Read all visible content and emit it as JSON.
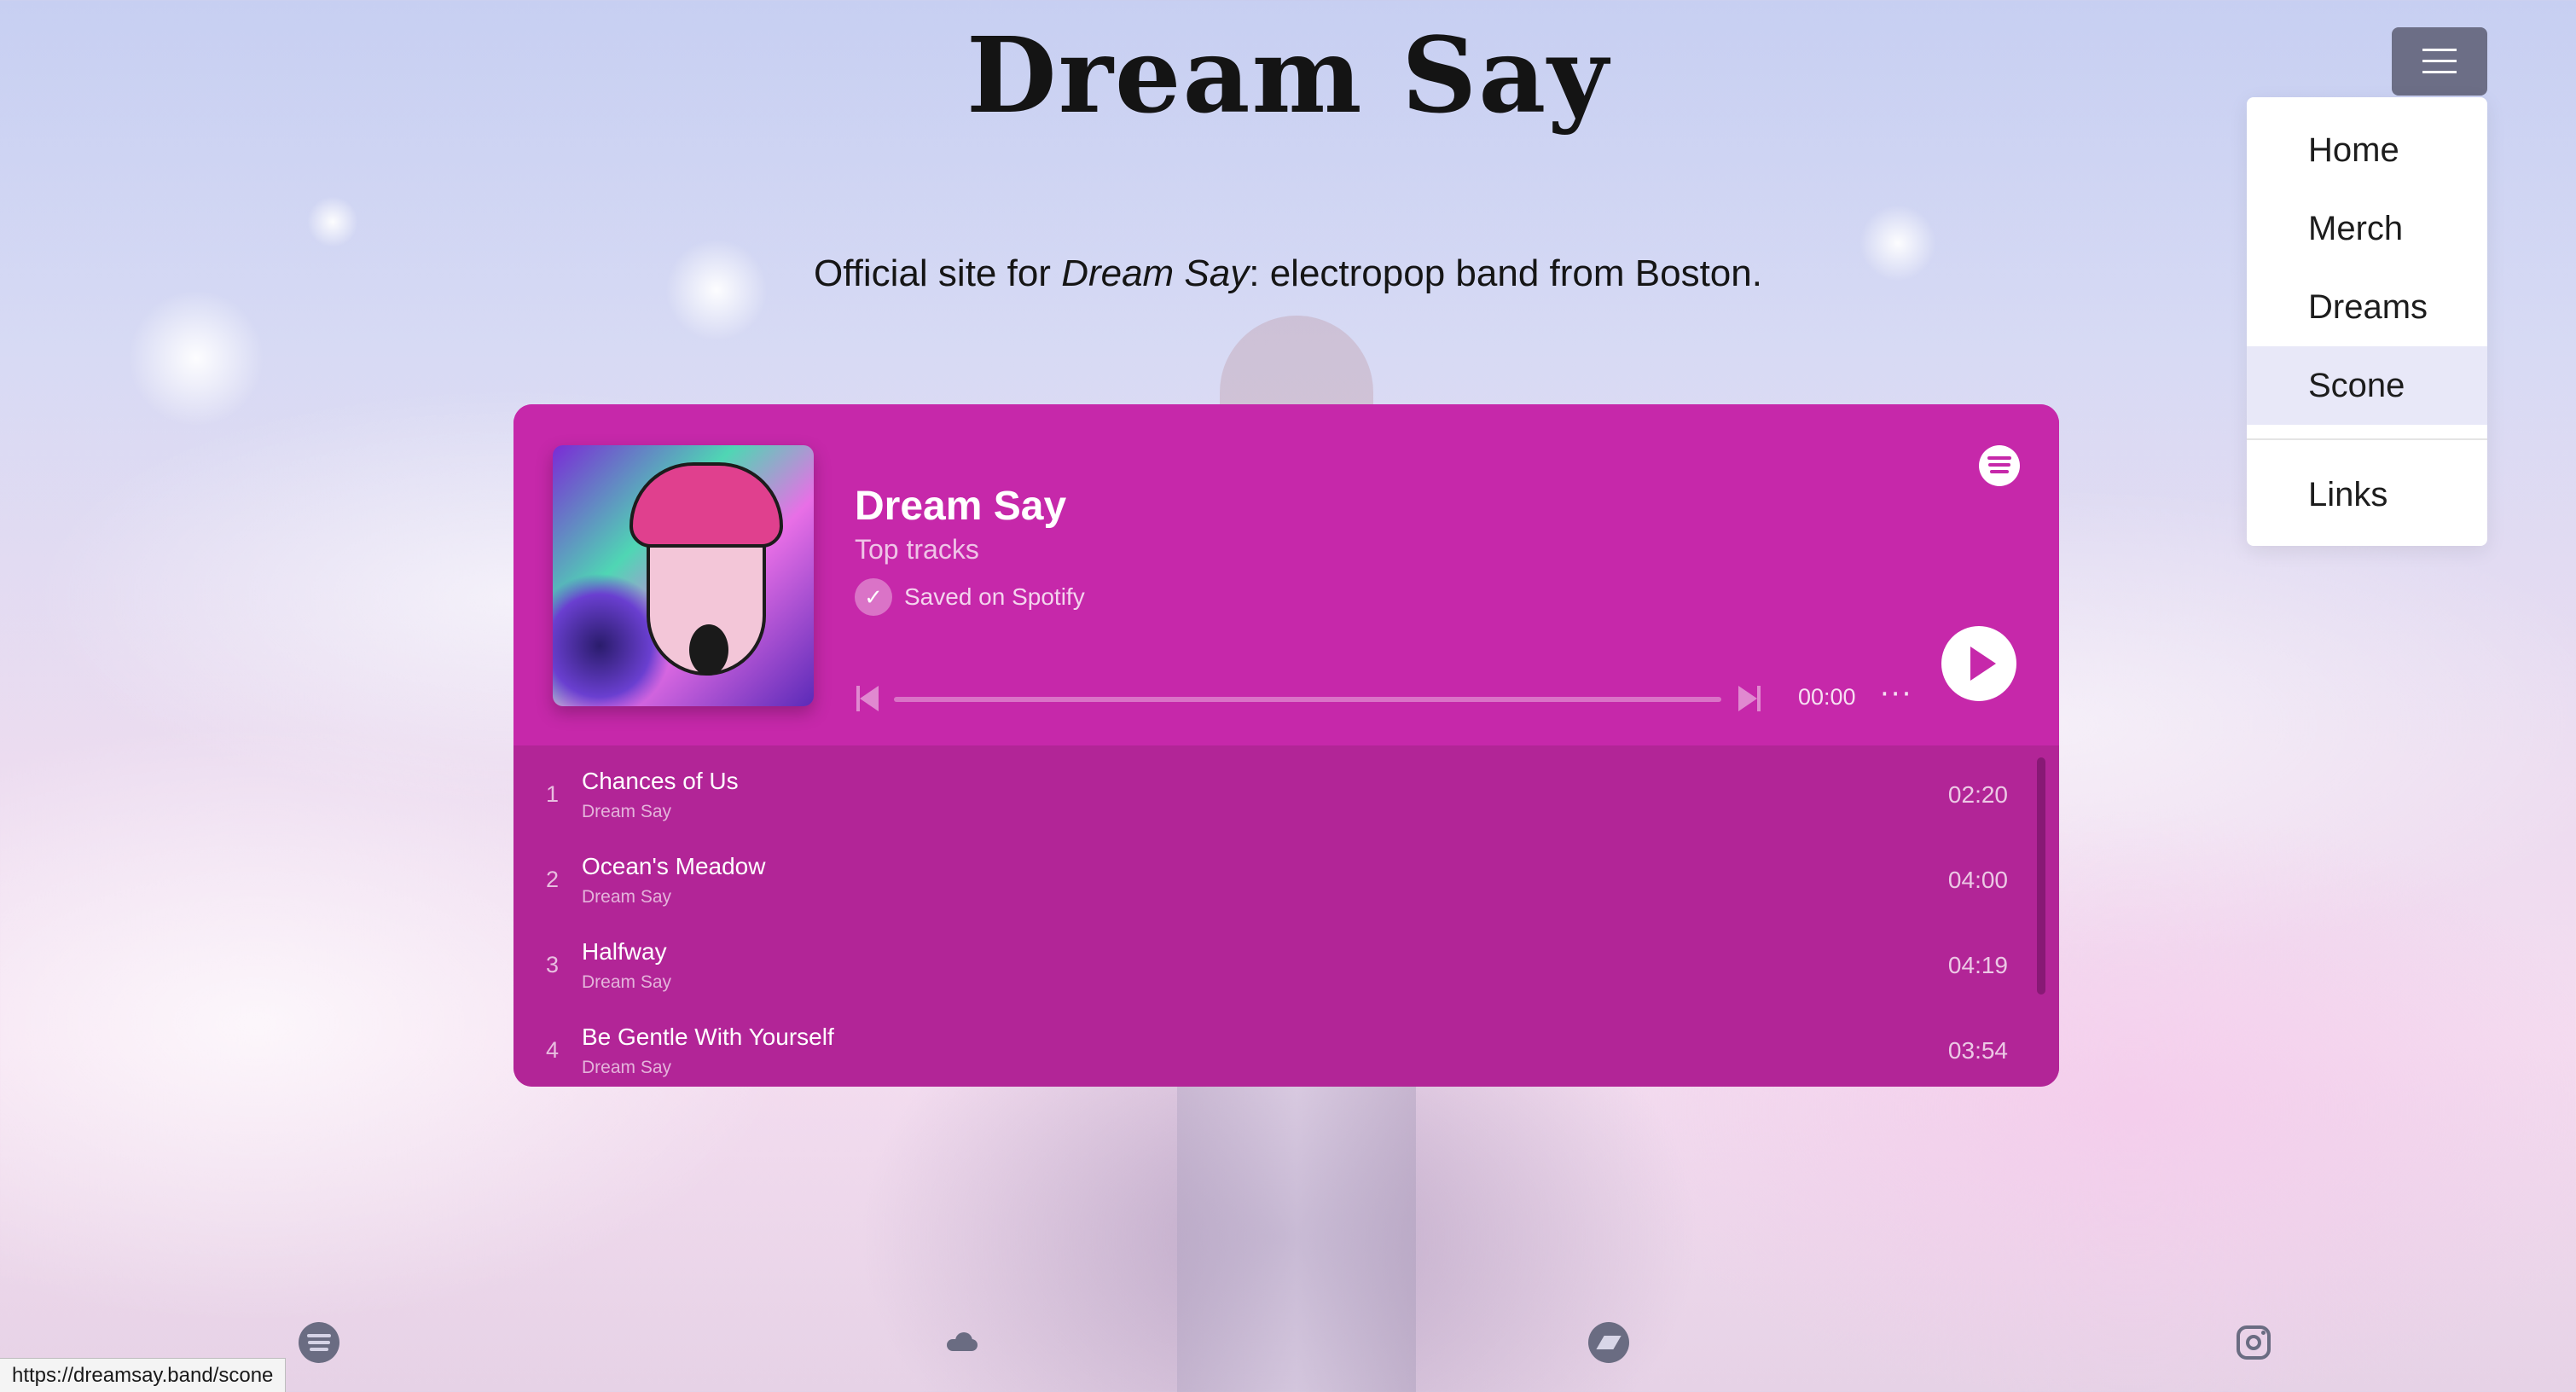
{
  "site": {
    "title": "Dream Say",
    "tagline_prefix": "Official site for ",
    "tagline_em": "Dream Say",
    "tagline_suffix": ": electropop band from Boston."
  },
  "menu": {
    "toggle_icon": "hamburger-icon",
    "items": [
      {
        "label": "Home"
      },
      {
        "label": "Merch"
      },
      {
        "label": "Dreams"
      },
      {
        "label": "Scone",
        "active": true
      },
      {
        "label": "Links"
      }
    ]
  },
  "player": {
    "title": "Dream Say",
    "subtitle": "Top tracks",
    "saved_label": "Saved on Spotify",
    "time": "00:00",
    "progress": 0,
    "more_label": "···",
    "accent_color": "#c628aa",
    "list_color": "#b22597",
    "tracks": [
      {
        "num": "1",
        "name": "Chances of Us",
        "artist": "Dream Say",
        "duration": "02:20"
      },
      {
        "num": "2",
        "name": "Ocean's Meadow",
        "artist": "Dream Say",
        "duration": "04:00"
      },
      {
        "num": "3",
        "name": "Halfway",
        "artist": "Dream Say",
        "duration": "04:19"
      },
      {
        "num": "4",
        "name": "Be Gentle With Yourself",
        "artist": "Dream Say",
        "duration": "03:54"
      }
    ]
  },
  "social": [
    "spotify-icon",
    "soundcloud-icon",
    "bandcamp-icon",
    "instagram-icon"
  ],
  "status_bar": {
    "url": "https://dreamsay.band/scone"
  }
}
